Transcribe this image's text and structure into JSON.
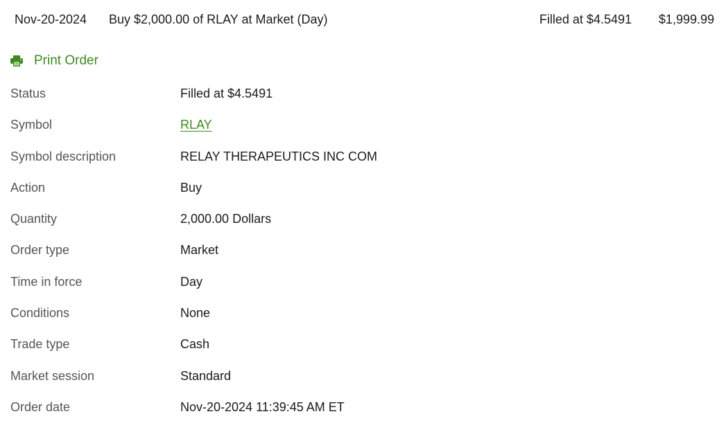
{
  "header": {
    "date": "Nov-20-2024",
    "description": "Buy $2,000.00 of RLAY at Market (Day)",
    "status": "Filled at $4.5491",
    "amount": "$1,999.99"
  },
  "print_order": {
    "label": "Print Order",
    "icon": "printer-icon",
    "color": "#3d8a1e"
  },
  "details": [
    {
      "label": "Status",
      "value": "Filled at $4.5491"
    },
    {
      "label": "Symbol",
      "value": "RLAY"
    },
    {
      "label": "Symbol description",
      "value": "RELAY THERAPEUTICS INC COM"
    },
    {
      "label": "Action",
      "value": "Buy"
    },
    {
      "label": "Quantity",
      "value": "2,000.00 Dollars"
    },
    {
      "label": "Order type",
      "value": "Market"
    },
    {
      "label": "Time in force",
      "value": "Day"
    },
    {
      "label": "Conditions",
      "value": "None"
    },
    {
      "label": "Trade type",
      "value": "Cash"
    },
    {
      "label": "Market session",
      "value": "Standard"
    },
    {
      "label": "Order date",
      "value": "Nov-20-2024 11:39:45 AM ET"
    }
  ]
}
